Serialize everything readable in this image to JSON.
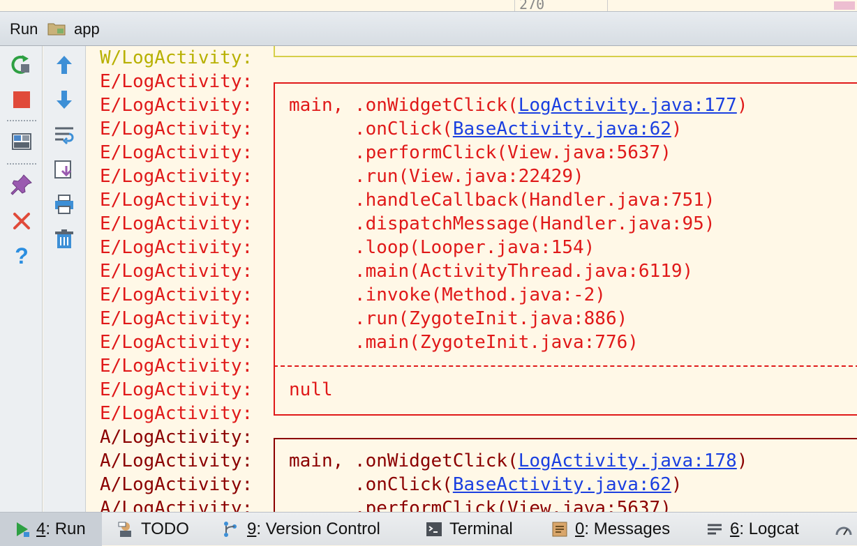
{
  "top_strip": {
    "number": "270"
  },
  "header": {
    "title": "Run",
    "app": "app"
  },
  "log_lines": [
    {
      "tag": "W/LogActivity:",
      "level": "W",
      "text": "",
      "link": "",
      "after": ""
    },
    {
      "tag": "E/LogActivity:",
      "level": "E",
      "text": "",
      "link": "",
      "after": ""
    },
    {
      "tag": "E/LogActivity:",
      "level": "E",
      "text": "main, .onWidgetClick(",
      "link": "LogActivity.java:177",
      "after": ")"
    },
    {
      "tag": "E/LogActivity:",
      "level": "E",
      "text": "      .onClick(",
      "link": "BaseActivity.java:62",
      "after": ")"
    },
    {
      "tag": "E/LogActivity:",
      "level": "E",
      "text": "      .performClick(View.java:5637)",
      "link": "",
      "after": ""
    },
    {
      "tag": "E/LogActivity:",
      "level": "E",
      "text": "      .run(View.java:22429)",
      "link": "",
      "after": ""
    },
    {
      "tag": "E/LogActivity:",
      "level": "E",
      "text": "      .handleCallback(Handler.java:751)",
      "link": "",
      "after": ""
    },
    {
      "tag": "E/LogActivity:",
      "level": "E",
      "text": "      .dispatchMessage(Handler.java:95)",
      "link": "",
      "after": ""
    },
    {
      "tag": "E/LogActivity:",
      "level": "E",
      "text": "      .loop(Looper.java:154)",
      "link": "",
      "after": ""
    },
    {
      "tag": "E/LogActivity:",
      "level": "E",
      "text": "      .main(ActivityThread.java:6119)",
      "link": "",
      "after": ""
    },
    {
      "tag": "E/LogActivity:",
      "level": "E",
      "text": "      .invoke(Method.java:-2)",
      "link": "",
      "after": ""
    },
    {
      "tag": "E/LogActivity:",
      "level": "E",
      "text": "      .run(ZygoteInit.java:886)",
      "link": "",
      "after": ""
    },
    {
      "tag": "E/LogActivity:",
      "level": "E",
      "text": "      .main(ZygoteInit.java:776)",
      "link": "",
      "after": ""
    },
    {
      "tag": "E/LogActivity:",
      "level": "E",
      "text": "",
      "link": "",
      "after": ""
    },
    {
      "tag": "E/LogActivity:",
      "level": "E",
      "text": "null",
      "link": "",
      "after": ""
    },
    {
      "tag": "E/LogActivity:",
      "level": "E",
      "text": "",
      "link": "",
      "after": ""
    },
    {
      "tag": "A/LogActivity:",
      "level": "A",
      "text": "",
      "link": "",
      "after": ""
    },
    {
      "tag": "A/LogActivity:",
      "level": "A",
      "text": "main, .onWidgetClick(",
      "link": "LogActivity.java:178",
      "after": ")"
    },
    {
      "tag": "A/LogActivity:",
      "level": "A",
      "text": "      .onClick(",
      "link": "BaseActivity.java:62",
      "after": ")"
    },
    {
      "tag": "A/LogActivity:",
      "level": "A",
      "text": "      .performClick(View.java:5637)",
      "link": "",
      "after": ""
    }
  ],
  "left_toolbar": [
    {
      "icon": "rerun-icon"
    },
    {
      "icon": "stop-icon"
    },
    {
      "icon": "restore-layout-icon"
    },
    {
      "icon": "pin-icon"
    },
    {
      "icon": "close-icon"
    },
    {
      "icon": "help-icon"
    }
  ],
  "second_toolbar": [
    {
      "icon": "arrow-up-icon"
    },
    {
      "icon": "arrow-down-icon"
    },
    {
      "icon": "soft-wrap-icon"
    },
    {
      "icon": "scroll-to-end-icon"
    },
    {
      "icon": "print-icon"
    },
    {
      "icon": "trash-icon"
    }
  ],
  "status_tabs": [
    {
      "num": "4",
      "label": ": Run",
      "icon": "run-icon",
      "active": true
    },
    {
      "num": "",
      "label": "TODO",
      "icon": "todo-icon",
      "active": false
    },
    {
      "num": "9",
      "label": ": Version Control",
      "icon": "version-control-icon",
      "active": false
    },
    {
      "num": "",
      "label": "Terminal",
      "icon": "terminal-icon",
      "active": false
    },
    {
      "num": "0",
      "label": ": Messages",
      "icon": "messages-icon",
      "active": false
    },
    {
      "num": "6",
      "label": ": Logcat",
      "icon": "logcat-icon",
      "active": false
    }
  ],
  "colors": {
    "warn": "#b8b000",
    "error": "#e01919",
    "assert": "#8b0000",
    "link": "#1a3fe0",
    "background": "#fff8e7"
  }
}
